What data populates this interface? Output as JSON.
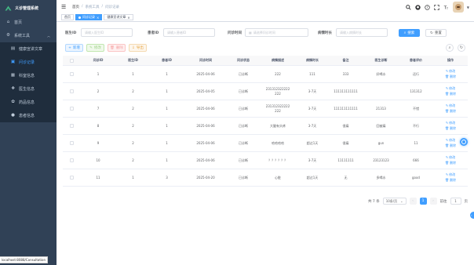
{
  "app": {
    "title": "义诊管理系统"
  },
  "sidebar": {
    "items": [
      {
        "label": "首页",
        "icon": "home-icon"
      },
      {
        "label": "系统工具",
        "icon": "tool-icon"
      }
    ],
    "submenu": [
      {
        "label": "健康宣讲文章",
        "icon": "article-icon"
      },
      {
        "label": "问诊记录",
        "icon": "record-icon",
        "active": true
      },
      {
        "label": "科室信息",
        "icon": "department-icon"
      },
      {
        "label": "医生信息",
        "icon": "doctor-icon"
      },
      {
        "label": "药品信息",
        "icon": "medicine-icon"
      },
      {
        "label": "患者信息",
        "icon": "patient-icon"
      }
    ],
    "status_url": "localhost:8088/Consultation"
  },
  "breadcrumb": [
    "首页",
    "/",
    "系统工具",
    "/",
    "问诊记录"
  ],
  "tags": [
    {
      "label": "首页",
      "active": false
    },
    {
      "label": "问诊记录",
      "active": true
    },
    {
      "label": "健康宣讲文章",
      "active": false
    }
  ],
  "search": {
    "fields": [
      {
        "label": "医生ID",
        "placeholder": "请输入医生ID"
      },
      {
        "label": "患者ID",
        "placeholder": "请输入患者ID"
      },
      {
        "label": "问诊时间",
        "placeholder": "请选择问诊时间"
      },
      {
        "label": "病情时长",
        "placeholder": "请输入病情时长"
      }
    ],
    "search_label": "搜索",
    "reset_label": "重置"
  },
  "toolbar": {
    "add_label": "新增",
    "edit_label": "修改",
    "delete_label": "删除",
    "export_label": "导出"
  },
  "table": {
    "columns": [
      "问诊ID",
      "医生ID",
      "患者ID",
      "问诊时间",
      "问诊状态",
      "病情描述",
      "病情时长",
      "备注",
      "医生诊断",
      "患者评价",
      "操作"
    ],
    "rows": [
      [
        "1",
        "1",
        "1",
        "2025-04-06",
        "已诊断",
        "222",
        "111",
        "333",
        "好喝水",
        "还行"
      ],
      [
        "2",
        "2",
        "1",
        "2025-04-05",
        "已诊断",
        "231312322222\n222",
        "3-7天",
        "111111111111",
        "",
        "131312"
      ],
      [
        "7",
        "2",
        "1",
        "2025-04-06",
        "已诊断",
        "231312322222\n222",
        "3-7天",
        "111111111111",
        "21313",
        "不错"
      ],
      [
        "8",
        "2",
        "1",
        "2025-04-06",
        "已诊断",
        "大腿有头疼",
        "3-7天",
        "很痛",
        "回被痛",
        "不行"
      ],
      [
        "9",
        "2",
        "1",
        "2025-04-06",
        "已诊断",
        "哈哈哈哈",
        "超过1天",
        "很痛",
        "gun",
        "11"
      ],
      [
        "10",
        "2",
        "1",
        "2025-04-06",
        "已诊断",
        "？？？？？？",
        "3-7天",
        "11111111",
        "23123123",
        "666"
      ],
      [
        "11",
        "1",
        "3",
        "2025-04-20",
        "已诊断",
        "心脏",
        "超过1天",
        "无",
        "多喝水",
        "good"
      ]
    ],
    "row_actions": [
      "修改",
      "删除"
    ]
  },
  "pagination": {
    "total": "共 7 条",
    "page_size": "10条/页",
    "current_page": "1",
    "goto_label": "前往",
    "goto_value": "1",
    "page_suffix": "页"
  }
}
